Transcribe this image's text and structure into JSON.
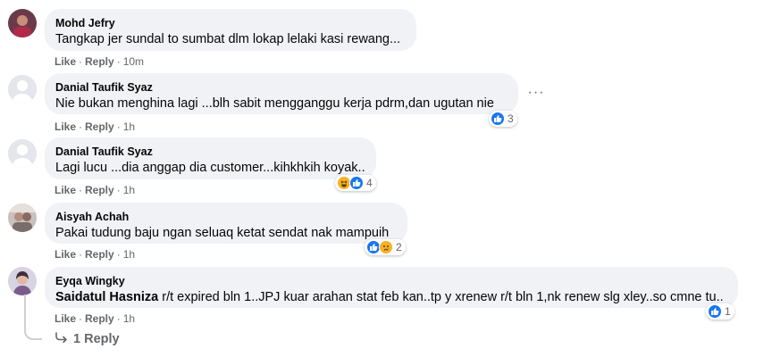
{
  "comments": [
    {
      "author": "Mohd Jefry",
      "text": "Tangkap jer sundal to sumbat dlm lokap lelaki kasi rewang...",
      "like": "Like",
      "reply": "Reply",
      "time": "10m",
      "avatar": "profile-photo"
    },
    {
      "author": "Danial Taufik Syaz",
      "text": "Nie bukan menghina lagi ...blh sabit mengganggu kerja pdrm,dan ugutan nie",
      "like": "Like",
      "reply": "Reply",
      "time": "1h",
      "reaction_count": "3",
      "reactions": [
        "like-icon"
      ],
      "avatar": "default-avatar"
    },
    {
      "author": "Danial Taufik Syaz",
      "text": "Lagi lucu ...dia anggap dia customer...kihkhkih koyak..",
      "like": "Like",
      "reply": "Reply",
      "time": "1h",
      "reaction_count": "4",
      "reactions": [
        "haha-icon",
        "like-icon"
      ],
      "avatar": "default-avatar"
    },
    {
      "author": "Aisyah Achah",
      "text": "Pakai tudung baju ngan seluaq ketat sendat nak mampuih",
      "like": "Like",
      "reply": "Reply",
      "time": "1h",
      "reaction_count": "2",
      "reactions": [
        "like-icon",
        "sad-icon"
      ],
      "avatar": "profile-photo"
    },
    {
      "author": "Eyqa Wingky",
      "mention": "Saidatul Hasniza",
      "text": " r/t expired bln 1..JPJ kuar arahan stat feb kan..tp y xrenew r/t bln 1,nk renew slg xley..so cmne tu..",
      "like": "Like",
      "reply": "Reply",
      "time": "1h",
      "reaction_count": "1",
      "reactions": [
        "like-icon"
      ],
      "avatar": "profile-photo"
    }
  ],
  "more_options": "···",
  "replies_link": "1 Reply",
  "colors": {
    "bubble": "#f0f2f5",
    "meta_text": "#65676b",
    "like_blue": "#1877f2",
    "emoji_yellow": "#f7b125"
  }
}
